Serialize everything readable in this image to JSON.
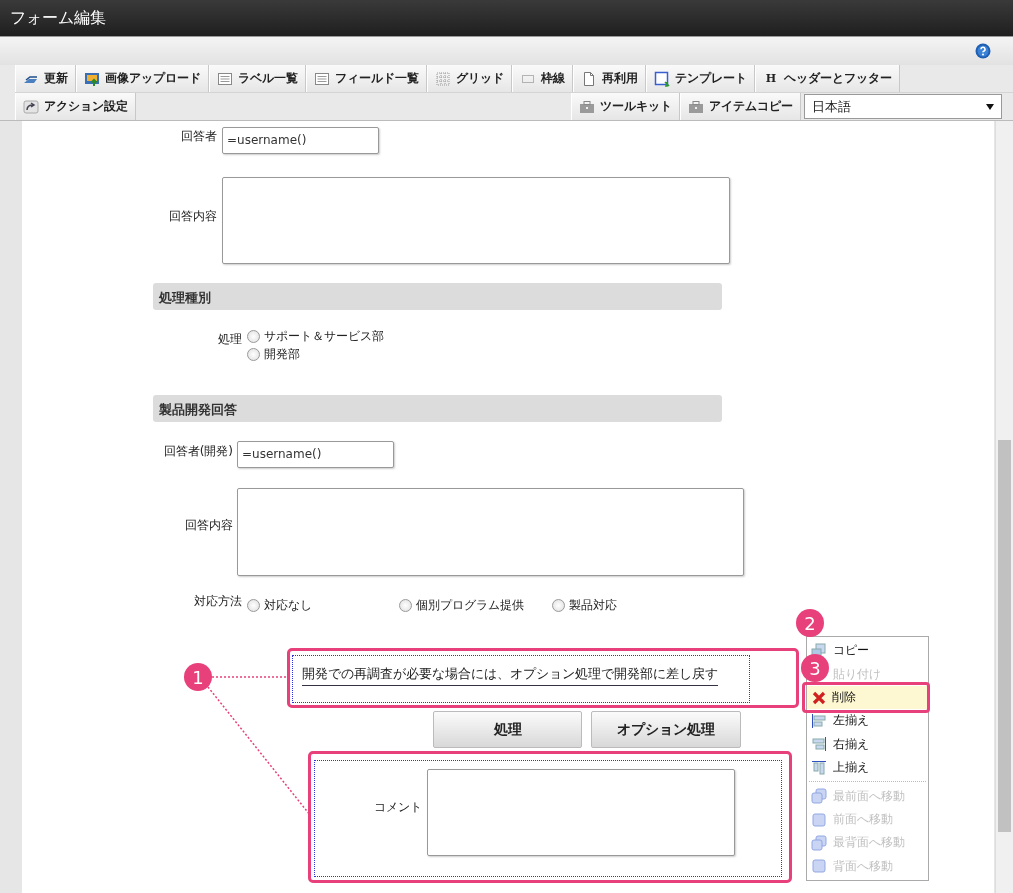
{
  "window": {
    "title": "フォーム編集"
  },
  "toolbar": {
    "row1": [
      {
        "label": "更新"
      },
      {
        "label": "画像アップロード"
      },
      {
        "label": "ラベル一覧"
      },
      {
        "label": "フィールド一覧"
      },
      {
        "label": "グリッド"
      },
      {
        "label": "枠線"
      },
      {
        "label": "再利用"
      },
      {
        "label": "テンプレート"
      },
      {
        "label": "ヘッダーとフッター",
        "glyph": "H"
      }
    ],
    "row2_left": [
      {
        "label": "アクション設定"
      }
    ],
    "row2_right": [
      {
        "label": "ツールキット"
      },
      {
        "label": "アイテムコピー"
      }
    ],
    "language_select": {
      "value": "日本語"
    }
  },
  "form": [
    {
      "kind": "text",
      "label": "回答者",
      "value": "=username()"
    },
    {
      "kind": "textarea",
      "label": "回答内容"
    },
    {
      "kind": "section",
      "title": "処理種別"
    },
    {
      "kind": "radio",
      "label": "処理",
      "options": [
        {
          "label": "サポート＆サービス部",
          "selected": false
        },
        {
          "label": "開発部",
          "selected": false
        }
      ]
    },
    {
      "kind": "section",
      "title": "製品開発回答"
    },
    {
      "kind": "text",
      "label": "回答者(開発)",
      "value": "=username()"
    },
    {
      "kind": "textarea",
      "label": "回答内容"
    },
    {
      "kind": "radio",
      "label": "対応方法",
      "options": [
        {
          "label": "対応なし",
          "selected": false
        },
        {
          "label": "個別プログラム提供",
          "selected": false
        },
        {
          "label": "製品対応",
          "selected": false
        }
      ]
    },
    {
      "kind": "note",
      "text": "開発での再調査が必要な場合には、オプション処理で開発部に差し戻す"
    },
    {
      "kind": "buttons",
      "buttons": [
        "処理",
        "オプション処理"
      ]
    },
    {
      "kind": "comment",
      "label": "コメント"
    }
  ],
  "context_menu": [
    {
      "label": "コピー",
      "disabled": false,
      "selected": false
    },
    {
      "label": "貼り付け",
      "disabled": true,
      "selected": false
    },
    {
      "label": "削除",
      "disabled": false,
      "selected": true
    },
    {
      "label": "左揃え",
      "disabled": false,
      "selected": false
    },
    {
      "label": "右揃え",
      "disabled": false,
      "selected": false
    },
    {
      "label": "上揃え",
      "disabled": false,
      "selected": false
    },
    {
      "label": "最前面へ移動",
      "disabled": true,
      "selected": false
    },
    {
      "label": "前面へ移動",
      "disabled": true,
      "selected": false
    },
    {
      "label": "最背面へ移動",
      "disabled": true,
      "selected": false
    },
    {
      "label": "背面へ移動",
      "disabled": true,
      "selected": false
    }
  ],
  "annotations": [
    {
      "label": "1"
    },
    {
      "label": "2"
    },
    {
      "label": "3"
    }
  ]
}
